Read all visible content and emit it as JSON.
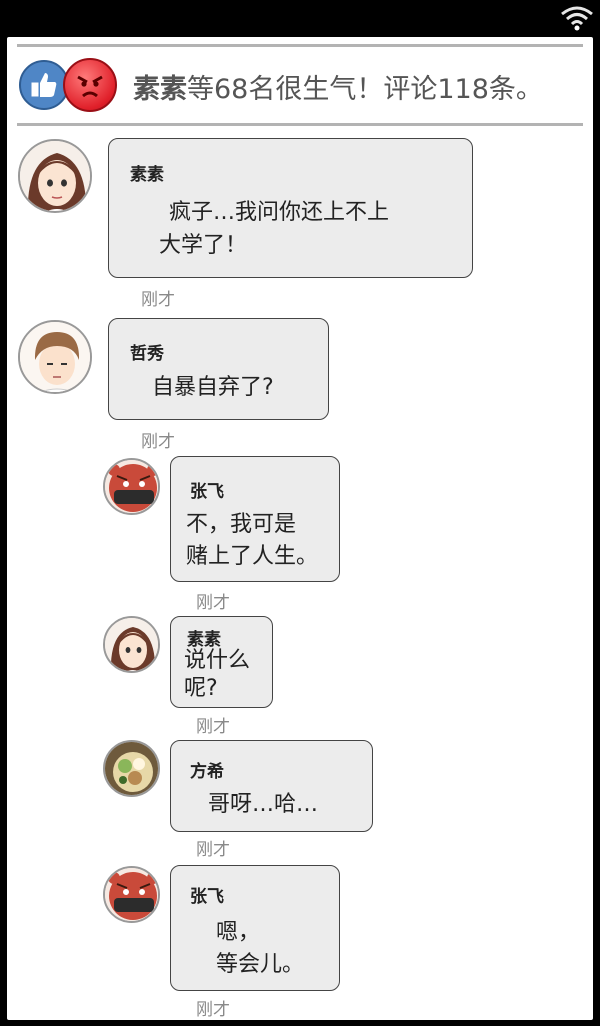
{
  "reaction_bar": {
    "summary_name": "素素",
    "summary_rest": "等68名很生气！评论118条。"
  },
  "messages": [
    {
      "sender": "素素",
      "lines": [
        "疯子…我问你还上不上",
        "大学了！"
      ],
      "time": "刚才",
      "avatar": "female-girl-avatar"
    },
    {
      "sender": "哲秀",
      "lines": [
        "自暴自弃了?"
      ],
      "time": "刚才",
      "avatar": "male-boy-avatar"
    },
    {
      "sender": "张飞",
      "lines": [
        "不，我可是",
        "赌上了人生。"
      ],
      "time": "刚才",
      "avatar": "tiger-masked-avatar"
    },
    {
      "sender": "素素",
      "lines": [
        "说什么",
        "呢?"
      ],
      "time": "刚才",
      "avatar": "female-girl-avatar"
    },
    {
      "sender": "方希",
      "lines": [
        "哥呀…哈…"
      ],
      "time": "刚才",
      "avatar": "dessert-avatar"
    },
    {
      "sender": "张飞",
      "lines": [
        "嗯，",
        "等会儿。"
      ],
      "time": "刚才",
      "avatar": "tiger-masked-avatar"
    }
  ],
  "colors": {
    "like_blue": "#4f86c6",
    "angry_red": "#e0202a",
    "bubble_fill": "#ececec",
    "divider_gray": "#b3b3b3"
  }
}
